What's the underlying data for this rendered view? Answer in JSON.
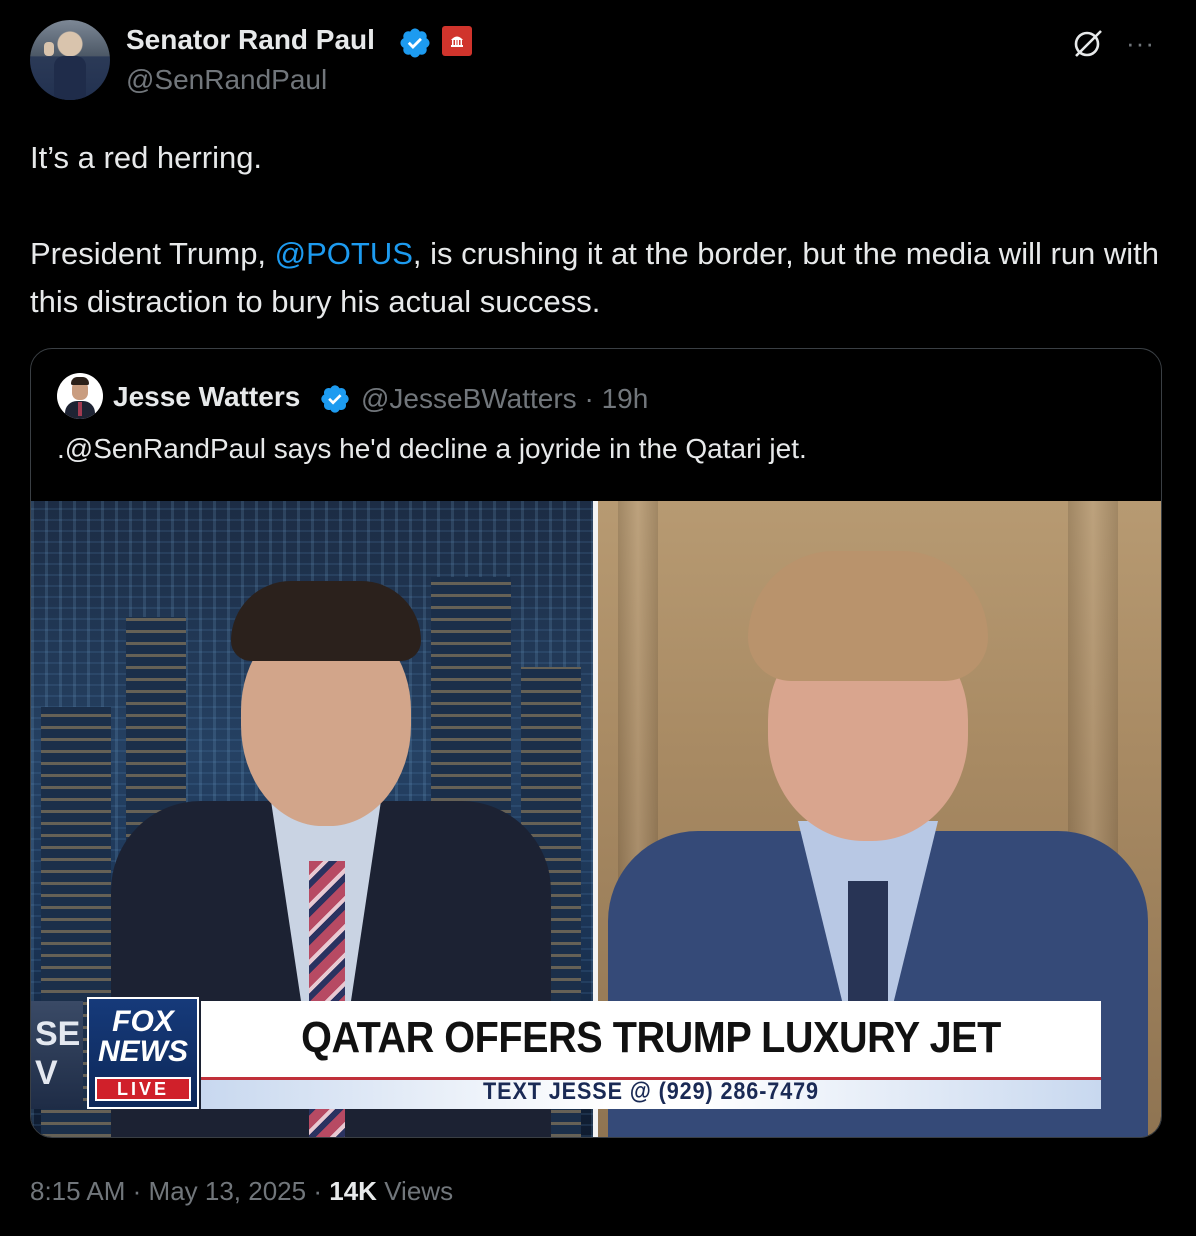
{
  "author": {
    "name": "Senator Rand Paul",
    "handle": "@SenRandPaul"
  },
  "tweet": {
    "line1": "It’s a red herring.",
    "para2_before": "President Trump, ",
    "mention": "@POTUS",
    "para2_after": ", is crushing it at the border, but the media will run with this distraction to bury his actual success."
  },
  "quoted": {
    "name": "Jesse Watters",
    "handle": "@JesseBWatters",
    "separator": "·",
    "time": "19h",
    "text": ".@SenRandPaul says he'd decline a joyride in the Qatari jet.",
    "media": {
      "headline": "QATAR OFFERS TRUMP LUXURY JET",
      "subline": "TEXT JESSE @ (929) 286-7479",
      "left_edge_text": "SE V",
      "logo_line1": "FOX",
      "logo_line2": "NEWS",
      "logo_badge": "LIVE"
    }
  },
  "footer": {
    "time": "8:15 AM",
    "sep1": "·",
    "date": "May 13, 2025",
    "sep2": "·",
    "views_count": "14K",
    "views_label": "Views"
  },
  "colors": {
    "background": "#000000",
    "text": "#e7e9ea",
    "muted": "#71767b",
    "link": "#1d9bf0",
    "verified": "#1d9bf0",
    "gov_badge": "#d0342c"
  },
  "icons": [
    "verified-badge-icon",
    "government-badge-icon",
    "grok-icon",
    "more-icon"
  ]
}
